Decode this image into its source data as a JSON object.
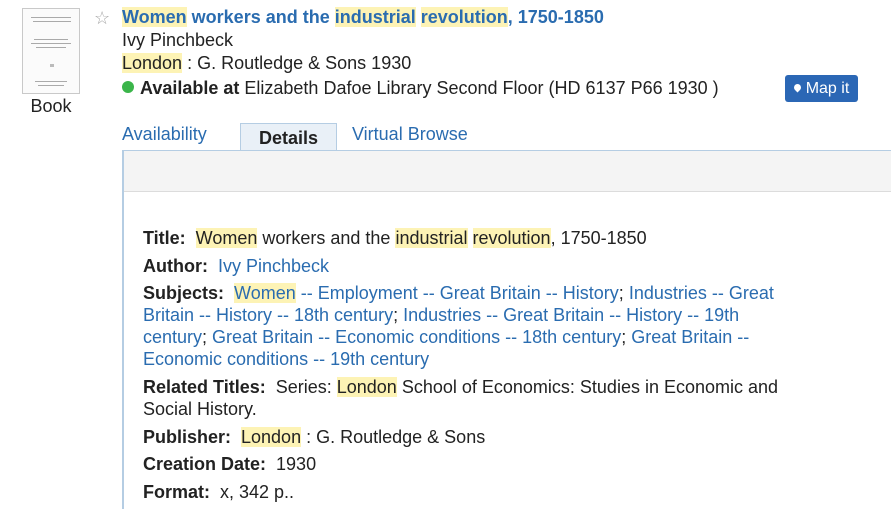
{
  "record": {
    "format_label": "Book",
    "title_parts": [
      "Women",
      " workers and the ",
      "industrial",
      " ",
      "revolution",
      ", 1750-1850"
    ],
    "author": "Ivy Pinchbeck",
    "pub_place": "London",
    "pub_rest": " : G. Routledge & Sons 1930",
    "availability_status": "Available at",
    "availability_location": " Elizabeth Dafoe Library Second Floor (HD 6137 P66 1930 )",
    "map_button": "Map it"
  },
  "tabs": [
    {
      "label": "Availability",
      "active": false
    },
    {
      "label": "Details",
      "active": true
    },
    {
      "label": "Virtual Browse",
      "active": false
    }
  ],
  "details": {
    "title_label": "Title:",
    "author_label": "Author:",
    "author_value": "Ivy Pinchbeck",
    "subjects_label": "Subjects:",
    "subjects_line1": [
      {
        "text": "Women",
        "hl": true
      },
      {
        "text": " -- Employment -- Great Britain -- History",
        "hl": false
      },
      {
        "text": "; ",
        "plain": true
      },
      {
        "text": "Industries -- Great",
        "hl": false
      }
    ],
    "subjects_line2": "Britain -- History -- 18th century",
    "subjects_line2b": "Industries -- Great Britain -- History -- 19th",
    "subjects_line3a": "century",
    "subjects_line3b": "Great Britain -- Economic conditions -- 18th century",
    "subjects_line3c": "Great Britain --",
    "subjects_line4": "Economic conditions -- 19th century",
    "related_label": "Related Titles:",
    "related_prefix": "Series: ",
    "related_hl": "London",
    "related_rest1": " School of Economics: Studies in Economic and",
    "related_rest2": "Social History.",
    "publisher_label": "Publisher:",
    "publisher_hl": "London",
    "publisher_rest": " : G. Routledge & Sons",
    "creation_label": "Creation Date:",
    "creation_value": "1930",
    "format_label": "Format:",
    "format_value": "x, 342 p.."
  },
  "colors": {
    "link": "#2a6cb0",
    "highlight": "#fdf3b5",
    "map_button": "#2b67b5",
    "available_dot": "#3bb54a"
  },
  "icons": {
    "favorite": "star-outline-icon",
    "availability": "green-dot-icon",
    "map": "map-pin-icon"
  }
}
